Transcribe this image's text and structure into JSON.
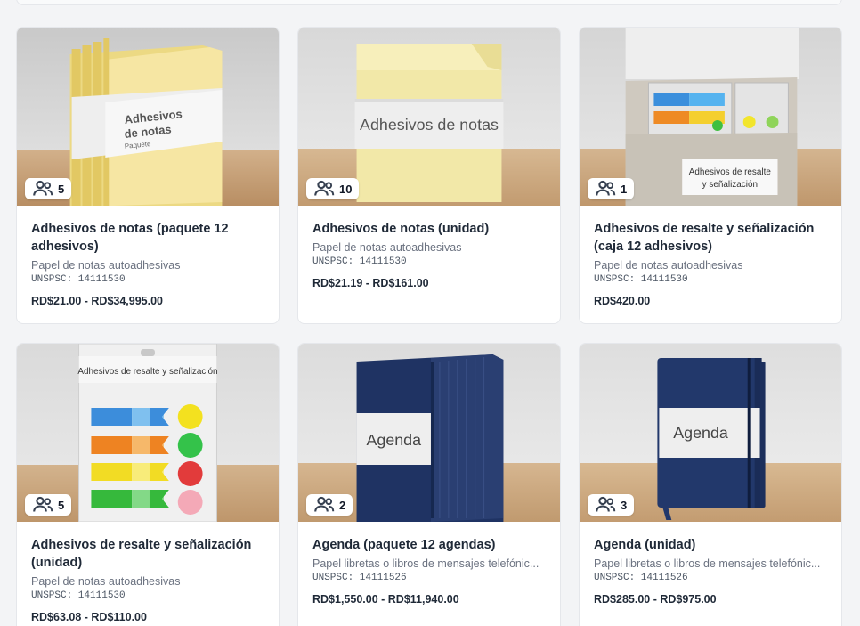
{
  "products": [
    {
      "members": "5",
      "title": "Adhesivos de notas (paquete 12 adhesivos)",
      "category": "Papel de notas autoadhesivas",
      "unspsc": "UNSPSC: 14111530",
      "price": "RD$21.00 - RD$34,995.00",
      "image_label": [
        "Adhesivos",
        "de notas",
        "Paquete"
      ]
    },
    {
      "members": "10",
      "title": "Adhesivos de notas (unidad)",
      "category": "Papel de notas autoadhesivas",
      "unspsc": "UNSPSC: 14111530",
      "price": "RD$21.19 - RD$161.00",
      "image_label": [
        "Adhesivos de notas"
      ]
    },
    {
      "members": "1",
      "title": "Adhesivos de resalte y señalización (caja 12 adhesivos)",
      "category": "Papel de notas autoadhesivas",
      "unspsc": "UNSPSC: 14111530",
      "price": "RD$420.00",
      "image_label": [
        "Adhesivos de resalte",
        "y señalización"
      ]
    },
    {
      "members": "5",
      "title": "Adhesivos de resalte y señalización (unidad)",
      "category": "Papel de notas autoadhesivas",
      "unspsc": "UNSPSC: 14111530",
      "price": "RD$63.08 - RD$110.00",
      "image_label": [
        "Adhesivos de resalte y señalización"
      ]
    },
    {
      "members": "2",
      "title": "Agenda (paquete 12 agendas)",
      "category": "Papel libretas o libros de mensajes telefónic...",
      "unspsc": "UNSPSC: 14111526",
      "price": "RD$1,550.00 - RD$11,940.00",
      "image_label": [
        "Agenda"
      ]
    },
    {
      "members": "3",
      "title": "Agenda (unidad)",
      "category": "Papel libretas o libros de mensajes telefónic...",
      "unspsc": "UNSPSC: 14111526",
      "price": "RD$285.00 - RD$975.00",
      "image_label": [
        "Agenda"
      ]
    }
  ],
  "icons": {
    "badge_icon": "users-icon"
  },
  "colors": {
    "page_bg": "#f3f4f6",
    "card_bg": "#ffffff",
    "note_yellow": "#f5ea9e",
    "agenda_navy": "#253a6b",
    "wood": "#c9a57d"
  }
}
